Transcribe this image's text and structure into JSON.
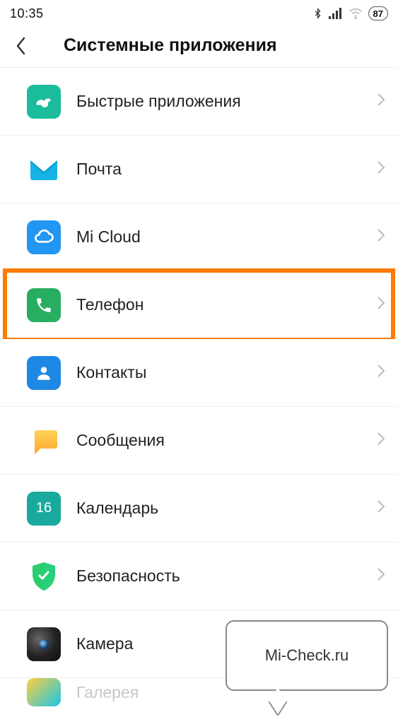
{
  "status": {
    "time": "10:35",
    "battery": "87"
  },
  "header": {
    "title": "Системные приложения"
  },
  "items": [
    {
      "id": "quick-apps",
      "label": "Быстрые приложения"
    },
    {
      "id": "mail",
      "label": "Почта"
    },
    {
      "id": "mi-cloud",
      "label": "Mi Cloud"
    },
    {
      "id": "phone",
      "label": "Телефон",
      "highlighted": true
    },
    {
      "id": "contacts",
      "label": "Контакты"
    },
    {
      "id": "messages",
      "label": "Сообщения"
    },
    {
      "id": "calendar",
      "label": "Календарь",
      "badge": "16"
    },
    {
      "id": "security",
      "label": "Безопасность"
    },
    {
      "id": "camera",
      "label": "Камера"
    },
    {
      "id": "gallery",
      "label": "Галерея"
    }
  ],
  "watermark": {
    "text": "Mi-Check.ru"
  }
}
